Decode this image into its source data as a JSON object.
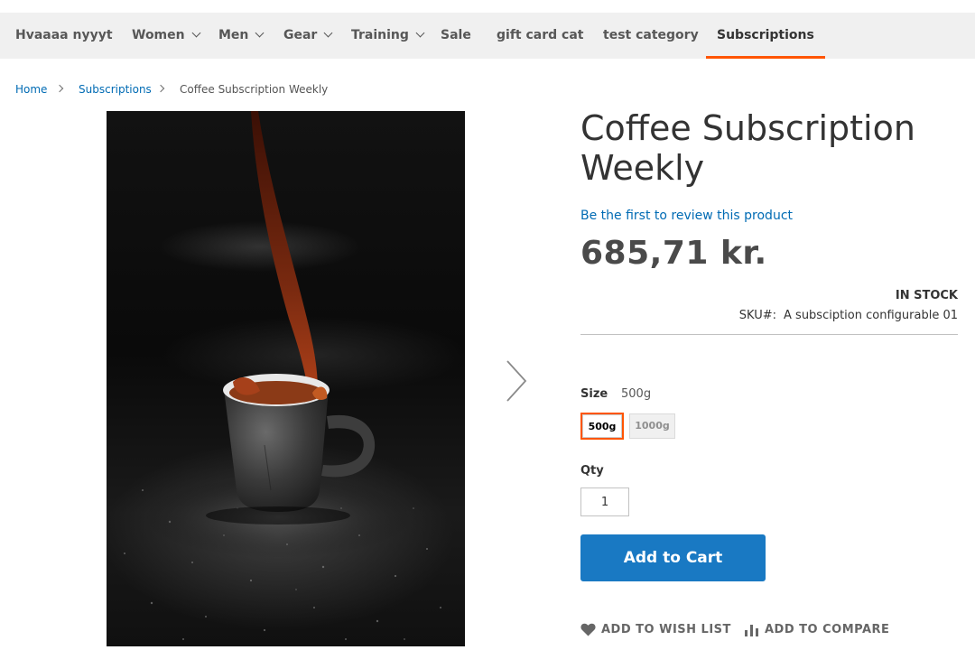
{
  "nav": {
    "items": [
      {
        "label": "Hvaaaa nyyyt",
        "has_submenu": false
      },
      {
        "label": "Women",
        "has_submenu": true
      },
      {
        "label": "Men",
        "has_submenu": true
      },
      {
        "label": "Gear",
        "has_submenu": true
      },
      {
        "label": "Training",
        "has_submenu": true
      },
      {
        "label": "Sale",
        "has_submenu": false
      },
      {
        "label": "gift card cat",
        "has_submenu": false
      },
      {
        "label": "test category",
        "has_submenu": false
      },
      {
        "label": "Subscriptions",
        "has_submenu": false,
        "active": true
      }
    ],
    "active_underline_color": "#ff5501"
  },
  "breadcrumb": {
    "home": "Home",
    "category": "Subscriptions",
    "current": "Coffee Subscription Weekly"
  },
  "gallery": {
    "image_description_icon": "coffee-pour-photo",
    "next_icon": "chevron-right-icon"
  },
  "product": {
    "title_line1": "Coffee Subscription",
    "title_line2": "Weekly",
    "review_link": "Be the first to review this product",
    "price": "685,71 kr.",
    "stock": "IN STOCK",
    "sku_label": "SKU#:",
    "sku_value": "A subsciption configurable 01",
    "size_label": "Size",
    "size_selected": "500g",
    "size_options": [
      "500g",
      "1000g"
    ],
    "qty_label": "Qty",
    "qty_value": "1",
    "add_to_cart": "Add to Cart",
    "wishlist": "ADD TO WISH LIST",
    "compare": "ADD TO COMPARE"
  },
  "colors": {
    "link": "#006bb4",
    "primary_button": "#1979c3",
    "accent": "#ff5501",
    "nav_background": "#f0f0f0"
  }
}
